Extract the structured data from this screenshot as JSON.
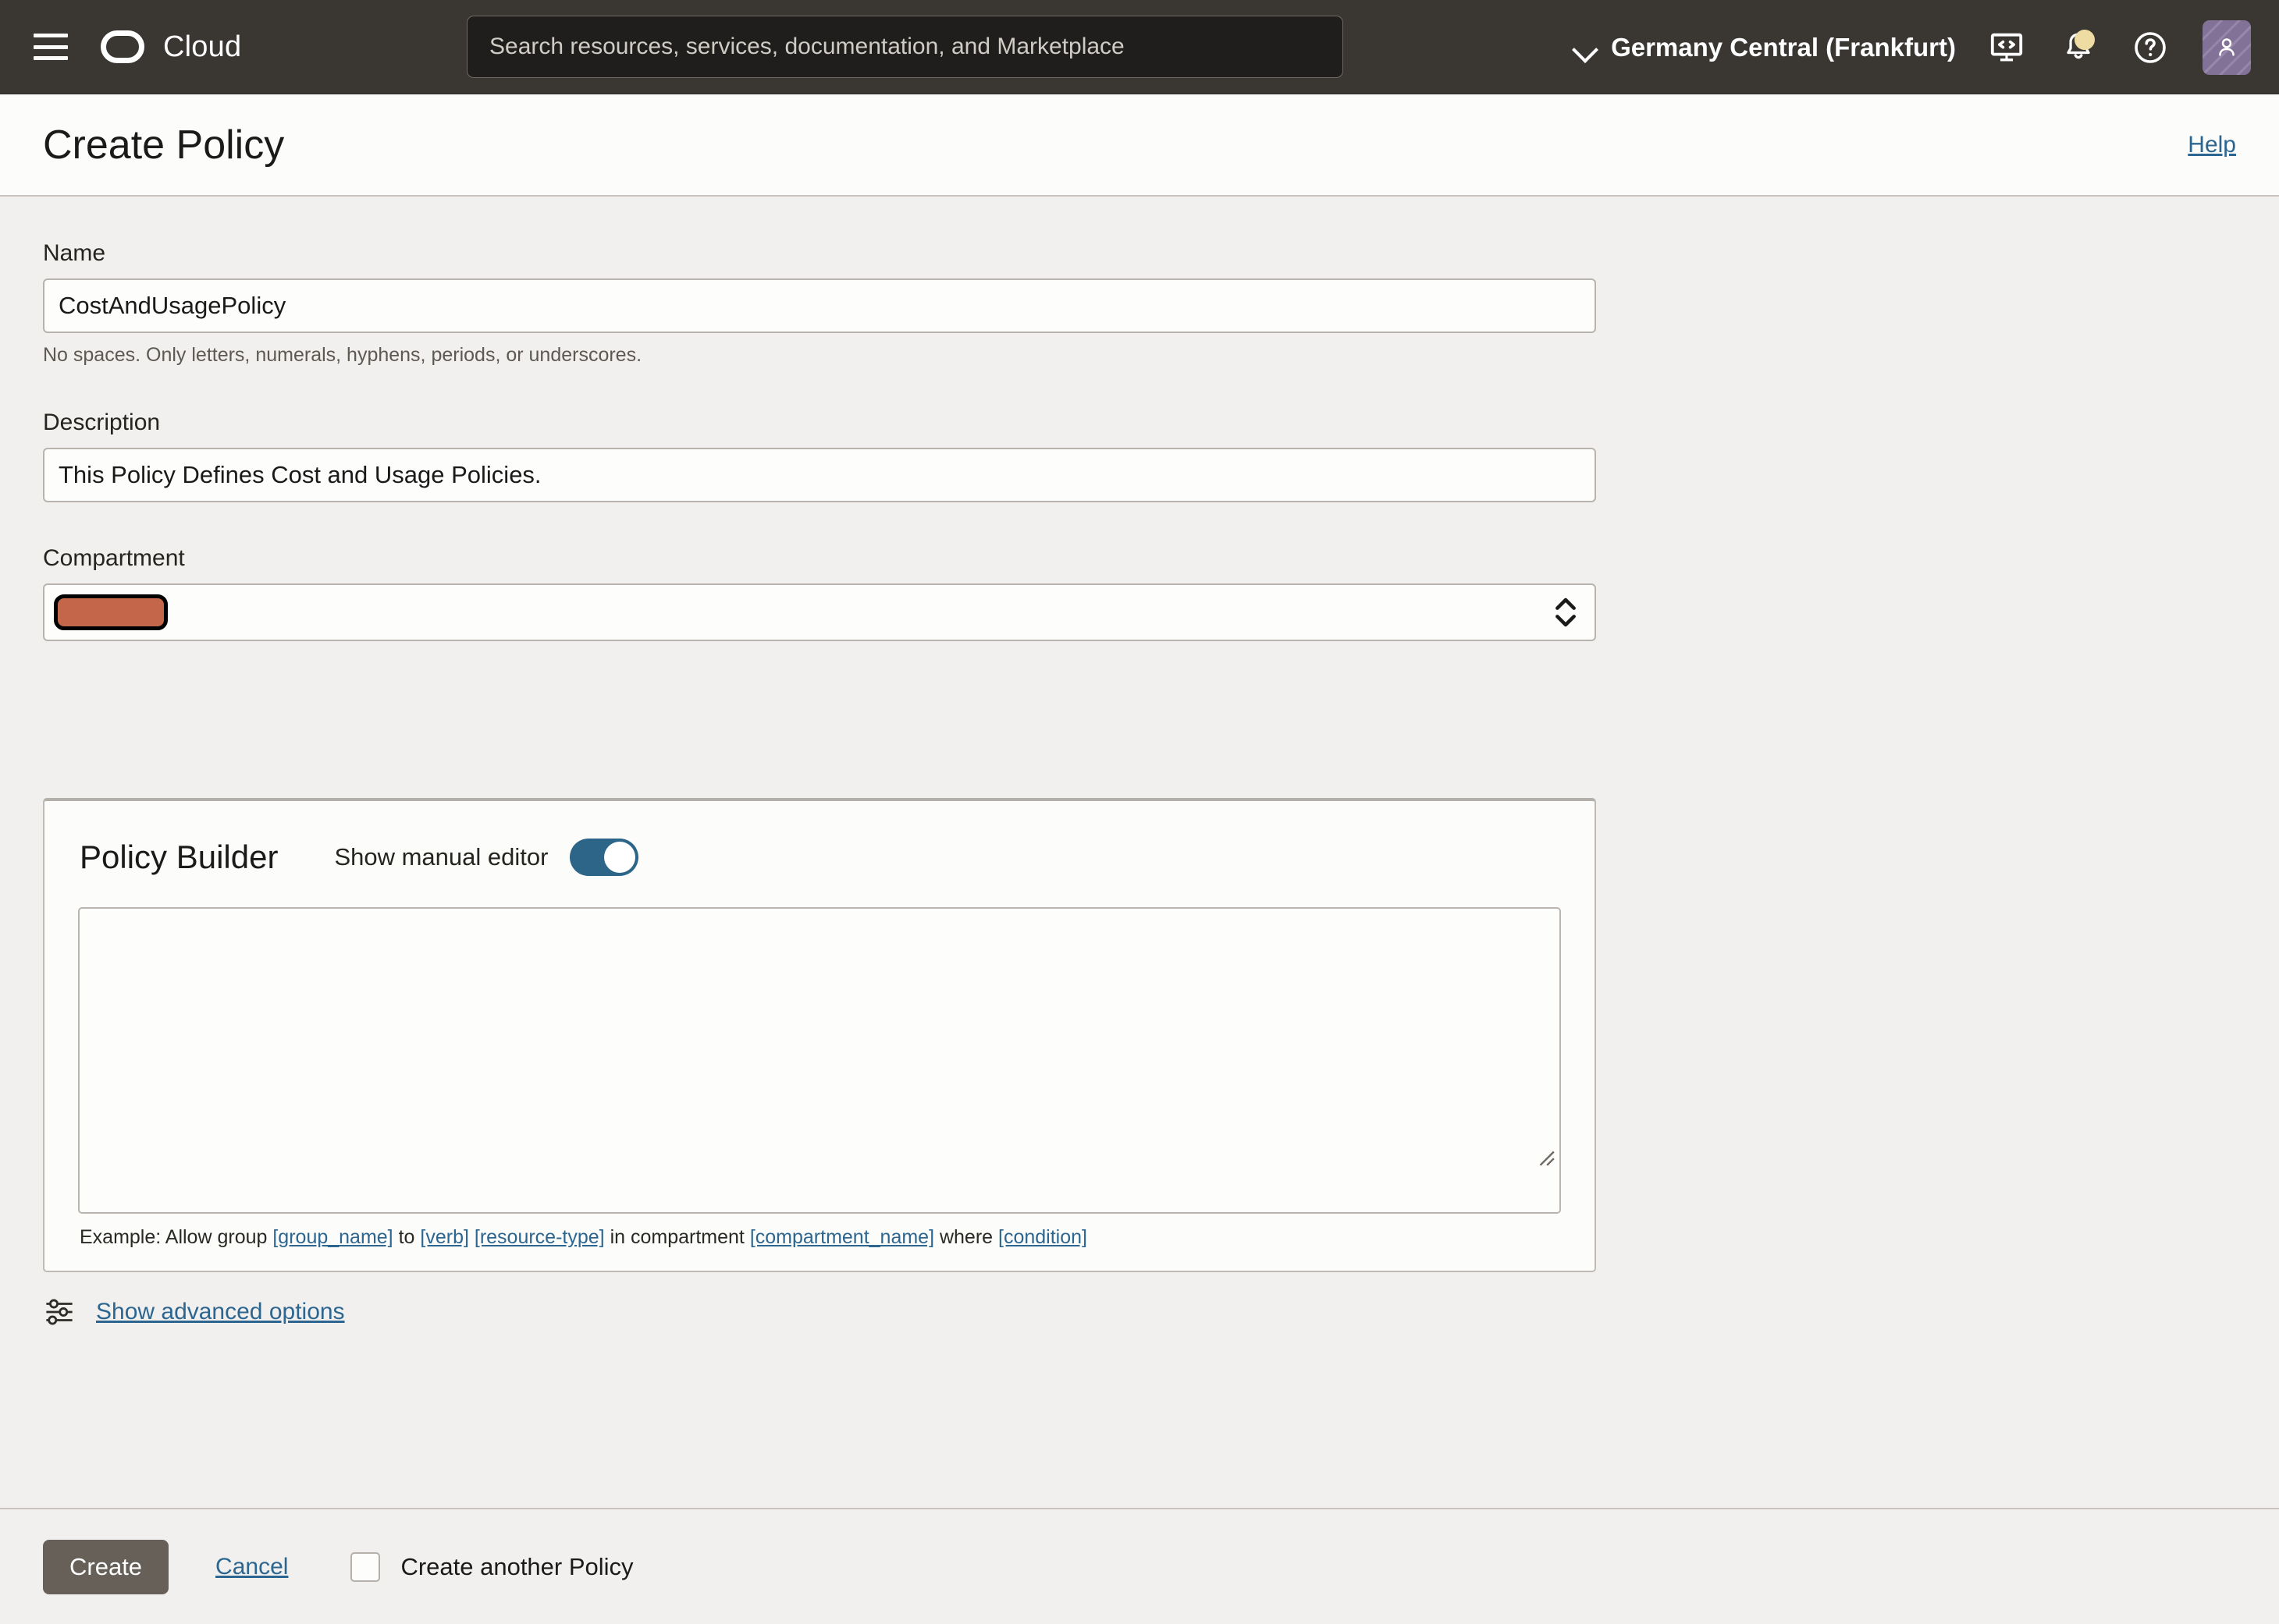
{
  "topnav": {
    "menu_icon": "hamburger-menu-icon",
    "brand": "Cloud",
    "brand_logo_icon": "cloud-logo-icon",
    "search": {
      "placeholder": "Search resources, services, documentation, and Marketplace",
      "value": ""
    },
    "region": {
      "label": "Germany Central (Frankfurt)",
      "chevron_icon": "chevron-down-icon"
    },
    "icons": {
      "cloud_shell": "code-monitor-icon",
      "notifications": "bell-icon",
      "help": "question-circle-icon",
      "avatar": "user-avatar-icon"
    },
    "colors": {
      "bar_background": "#3a3733",
      "search_background": "#201e1c",
      "badge": "#efdca2",
      "avatar": "#8d7ba3"
    }
  },
  "pageheader": {
    "title": "Create Policy",
    "help_label": "Help"
  },
  "form": {
    "name": {
      "label": "Name",
      "value": "CostAndUsagePolicy",
      "placeholder": "",
      "helper": "No spaces. Only letters, numerals, hyphens, periods, or underscores."
    },
    "description": {
      "label": "Description",
      "value": "This Policy Defines Cost and Usage Policies.",
      "placeholder": ""
    },
    "compartment": {
      "label": "Compartment",
      "value": "",
      "redacted": true,
      "redaction_color": "#c4664a",
      "stepper_icon": "chevron-up-down-icon"
    }
  },
  "policy_builder": {
    "title": "Policy Builder",
    "toggle_label": "Show manual editor",
    "toggle_on": true,
    "toggle_color": "#2d6588",
    "editor": {
      "value": "",
      "placeholder": ""
    },
    "example": {
      "prefix": "Example: Allow group ",
      "group_name": "[group_name]",
      "mid1": " to ",
      "verb": "[verb]",
      "mid2": " ",
      "resource_type": "[resource-type]",
      "mid3": " in compartment ",
      "compartment_name": "[compartment_name]",
      "mid4": " where ",
      "condition": "[condition]"
    }
  },
  "advanced": {
    "label": "Show advanced options",
    "icon": "sliders-icon"
  },
  "footer": {
    "create_label": "Create",
    "cancel_label": "Cancel",
    "create_another_label": "Create another Policy",
    "create_another_checked": false
  }
}
